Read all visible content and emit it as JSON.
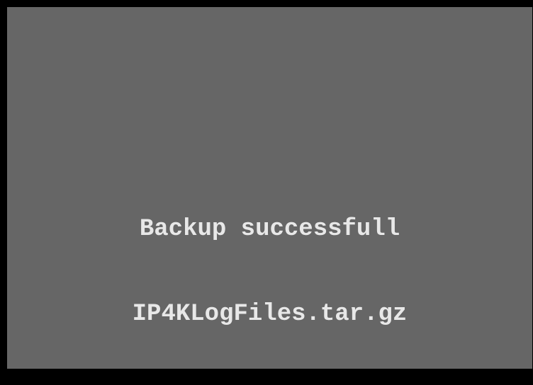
{
  "message": {
    "status_text": "Backup successfull",
    "file_name": "IP4KLogFiles.tar.gz"
  },
  "colors": {
    "frame": "#000000",
    "screen_background": "#666666",
    "text": "#e8e8e8"
  }
}
